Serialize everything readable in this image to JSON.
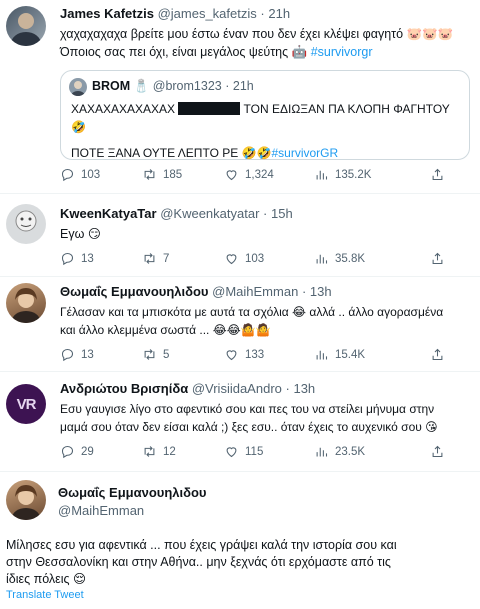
{
  "tweets": [
    {
      "name": "James Kafetzis",
      "handle": "@james_kafetzis",
      "dot": "·",
      "time": "21h",
      "line1": "χαχαχαχαχα βρείτε μου έστω έναν που δεν έχει κλέψει φαγητό 🐷🐷🐷",
      "line2": "Όποιος σας πει όχι, είναι μεγάλος ψεύτης 🤖",
      "hashtag": "#survivorgr",
      "quote": {
        "name": "BROM",
        "handle": "@brom1323",
        "time": "21h",
        "text_a": "ΧΑΧΑΧΑΧΑΧΑΧΑΧ",
        "text_b": "ΤΟΝ ΕΔΙΩΞΑΝ ΠΑ ΚΛΟΠΗ ΦΑΓΗΤΟΥ 🤣",
        "text2": "ΠΟΤΕ ΞΑΝΑ ΟΥΤΕ ΛΕΠΤΟ ΡΕ 🤣🤣",
        "hashtag": "#survivorGR"
      },
      "replies": "103",
      "retweets": "185",
      "likes": "1,324",
      "views": "135.2K"
    },
    {
      "name": "KweenKatyaTar",
      "handle": "@Kweenkatyatar",
      "dot": "·",
      "time": "15h",
      "text": "Εγω 😏",
      "replies": "13",
      "retweets": "7",
      "likes": "103",
      "views": "35.8K"
    },
    {
      "name": "Θωμαΐς Εμμανουηλιδου",
      "handle": "@MaihEmman",
      "dot": "·",
      "time": "13h",
      "line1": "Γέλασαν και τα μπισκότα με αυτά τα σχόλια 😂 αλλά .. άλλο αγορασμένα",
      "line2": "και άλλο κλεμμένα σωστά ... 😂😂🤷🤷",
      "replies": "13",
      "retweets": "5",
      "likes": "133",
      "views": "15.4K"
    },
    {
      "name": "Ανδριώτου Βρισηίδα",
      "handle": "@VrisiidaAndro",
      "dot": "·",
      "time": "13h",
      "avatar_text": "VR",
      "line1": "Εσυ γαυγισε λίγο στο αφεντικό σου και πες του να στείλει μήνυμα στην",
      "line2": "μαμά σου όταν δεν είσαι καλά ;) ξες εσυ.. όταν έχεις το αυχενικό σου 😘",
      "replies": "29",
      "retweets": "12",
      "likes": "115",
      "views": "23.5K"
    },
    {
      "name": "Θωμαΐς Εμμανουηλιδου",
      "handle": "@MaihEmman",
      "line1": "Μίλησες εσυ για αφεντικά ... που έχεις γράψει καλά την ιστορία σου και",
      "line2": "στην Θεσσαλονίκη και στην Αθήνα.. μην ξεχνάς ότι ερχόμαστε από τις",
      "line3": "ίδιες πόλεις 😌",
      "translate": "Translate Tweet"
    }
  ],
  "colors": {
    "link": "#1d9bf0",
    "muted": "#536471",
    "text": "#0f1419"
  },
  "icons": [
    "reply-icon",
    "retweet-icon",
    "like-icon",
    "views-icon",
    "share-icon"
  ]
}
